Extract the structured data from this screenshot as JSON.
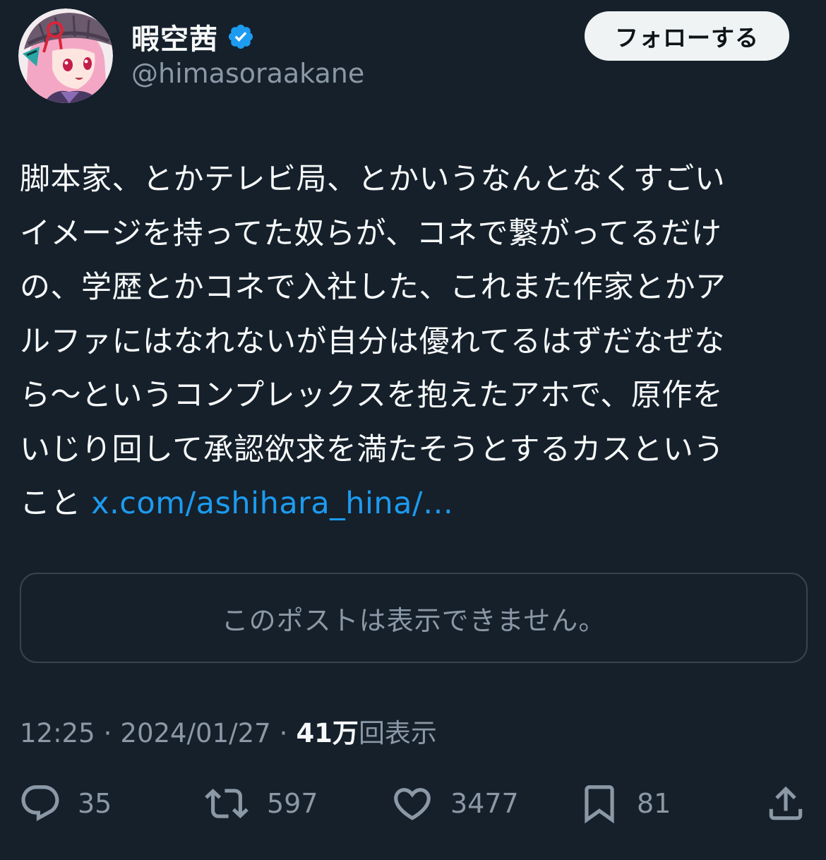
{
  "author": {
    "display_name": "暇空茜",
    "handle": "@himasoraakane",
    "avatar_icon": "anime-character-avatar",
    "verified_icon": "verified-badge-icon"
  },
  "follow_button": {
    "label": "フォローする"
  },
  "tweet": {
    "lines": [
      "脚本家、とかテレビ局、とかいうなんとなくすごい",
      "イメージを持ってた奴らが、コネで繋がってるだけ",
      "の、学歴とかコネで入社した、これまた作家とかア",
      "ルファにはなれないが自分は優れてるはずだなぜな",
      "ら～というコンプレックスを抱えたアホで、原作を",
      "いじり回して承認欲求を満たそうとするカスという"
    ],
    "last_line_text": "こと",
    "link_text": "x.com/ashihara_hina/…"
  },
  "quote": {
    "unavailable_text": "このポストは表示できません。"
  },
  "meta": {
    "time": "12:25",
    "separator": "·",
    "date": "2024/01/27",
    "views_count": "41万",
    "views_label": "回表示"
  },
  "actions": {
    "reply_count": "35",
    "repost_count": "597",
    "like_count": "3477",
    "bookmark_count": "81"
  },
  "colors": {
    "background": "#15202b",
    "text": "#f7f9f9",
    "secondary": "#8b98a5",
    "link": "#1d9bf0",
    "verified": "#1d9bf0"
  }
}
